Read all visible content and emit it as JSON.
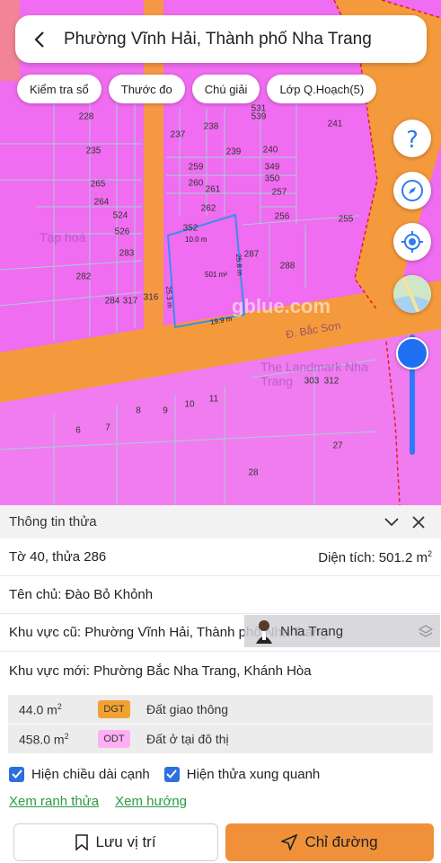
{
  "header": {
    "title": "Phường Vĩnh Hải, Thành phố Nha Trang"
  },
  "chips": [
    "Kiểm tra sổ",
    "Thước đo",
    "Chú giải",
    "Lớp Q.Hoạch(5)"
  ],
  "map": {
    "parcel_numbers": [
      "531",
      "539",
      "228",
      "237",
      "238",
      "241",
      "235",
      "239",
      "240",
      "259",
      "349",
      "265",
      "260",
      "261",
      "350",
      "257",
      "264",
      "262",
      "256",
      "255",
      "524",
      "352",
      "526",
      "283",
      "287",
      "288",
      "282",
      "284",
      "317",
      "316",
      "303",
      "312",
      "11",
      "10",
      "8",
      "9",
      "6",
      "7",
      "27",
      "28"
    ],
    "dimensions": {
      "top": "10.0 m",
      "area": "501 m²",
      "right": "25.8 m",
      "left": "25.3 m",
      "bottom": "19.9 m"
    },
    "poi_labels": [
      "Tạp hoá",
      "The Landmark Nha Trang",
      "Đ. Bắc Sơn"
    ],
    "watermark": "gblue.com"
  },
  "panel": {
    "title": "Thông tin thửa",
    "sheet_parcel": "Tờ 40, thửa 286",
    "area_label": "Diện tích: 501.2 m",
    "area_unit_sup": "2",
    "owner": "Tên chủ: Đào Bỏ Khỏnh",
    "old_area": "Khu vực cũ: Phường Vĩnh Hải, Thành phố Nha Trang",
    "overlay_text": "Nha Trang",
    "new_area": "Khu vực mới: Phường Bắc Nha Trang, Khánh Hòa",
    "land_uses": [
      {
        "area": "44.0 m",
        "sup": "2",
        "code": "DGT",
        "name": "Đất giao thông"
      },
      {
        "area": "458.0 m",
        "sup": "2",
        "code": "ODT",
        "name": "Đất ở tại đô thị"
      }
    ],
    "checkboxes": [
      "Hiện chiều dài cạnh",
      "Hiện thửa xung quanh"
    ],
    "links": [
      "Xem ranh thửa",
      "Xem hướng"
    ],
    "save_label": "Lưu vị trí",
    "go_label": "Chỉ đường"
  },
  "colors": {
    "residential": "#f06cf0",
    "road": "#f59a3c",
    "accent": "#1f6ff2",
    "link": "#2a9a44"
  }
}
